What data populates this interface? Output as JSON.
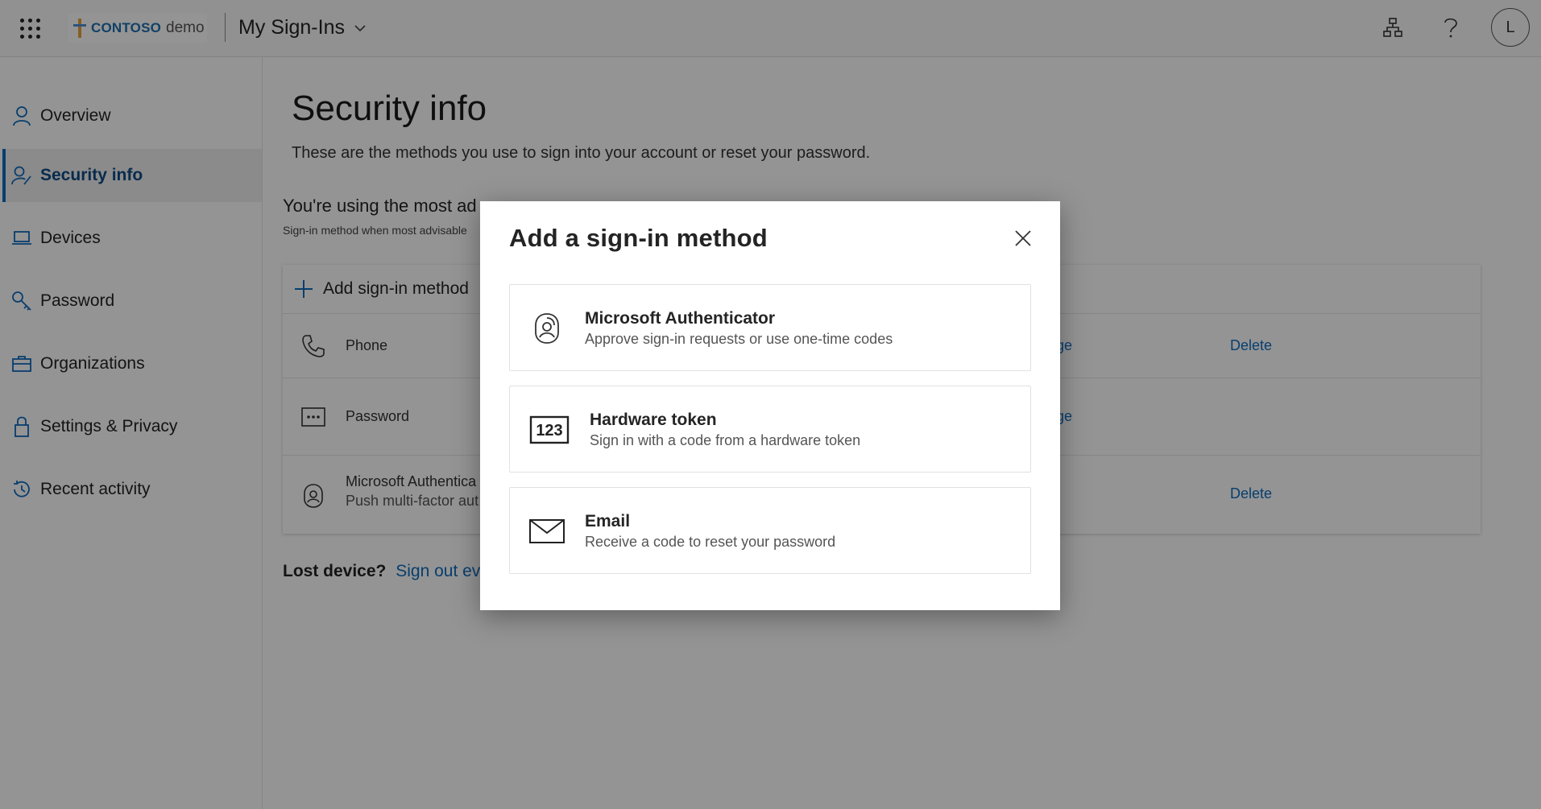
{
  "header": {
    "brand": "CONTOSO",
    "brand_suffix": "demo",
    "app_title": "My Sign-Ins",
    "avatar_initial": "L"
  },
  "sidebar": {
    "items": [
      {
        "label": "Overview",
        "icon": "person-icon"
      },
      {
        "label": "Security info",
        "icon": "person-key-icon",
        "active": true
      },
      {
        "label": "Devices",
        "icon": "laptop-icon"
      },
      {
        "label": "Password",
        "icon": "key-icon"
      },
      {
        "label": "Organizations",
        "icon": "briefcase-icon"
      },
      {
        "label": "Settings & Privacy",
        "icon": "lock-icon"
      },
      {
        "label": "Recent activity",
        "icon": "history-icon"
      }
    ]
  },
  "main": {
    "title": "Security info",
    "description": "These are the methods you use to sign into your account or reset your password.",
    "advisable_title": "You're using the most ad",
    "advisable_sub": "Sign-in method when most advisable",
    "add_method_label": "Add sign-in method",
    "methods": [
      {
        "name": "Phone",
        "icon": "phone-icon",
        "change": "ge",
        "delete": "Delete"
      },
      {
        "name": "Password",
        "icon": "password-dots-icon",
        "change": "ge"
      },
      {
        "name": "Microsoft Authentica",
        "detail": "Push multi-factor aut",
        "icon": "authenticator-icon",
        "delete": "Delete"
      }
    ],
    "lost_device_label": "Lost device?",
    "lost_device_link": "Sign out ever"
  },
  "dialog": {
    "title": "Add a sign-in method",
    "options": [
      {
        "title": "Microsoft Authenticator",
        "description": "Approve sign-in requests or use one-time codes",
        "icon": "authenticator-icon"
      },
      {
        "title": "Hardware token",
        "description": "Sign in with a code from a hardware token",
        "icon": "hardware-token-icon",
        "icon_text": "123"
      },
      {
        "title": "Email",
        "description": "Receive a code to reset your password",
        "icon": "envelope-icon"
      }
    ]
  },
  "colors": {
    "accent": "#0f6cbd",
    "overlay": "rgba(0,0,0,0.42)"
  }
}
